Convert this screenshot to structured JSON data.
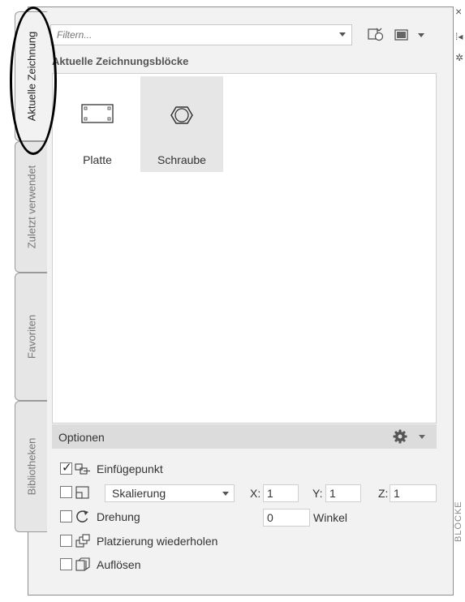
{
  "tabs": [
    {
      "label": "Aktuelle Zeichnung",
      "active": true
    },
    {
      "label": "Zuletzt verwendet",
      "active": false
    },
    {
      "label": "Favoriten",
      "active": false
    },
    {
      "label": "Bibliotheken",
      "active": false
    }
  ],
  "filter": {
    "placeholder": "Filtern..."
  },
  "toolbar": {
    "reload_icon": "load-icon",
    "view_icon": "thumbnail-view-icon"
  },
  "section_title": "Aktuelle Zeichnungsblöcke",
  "blocks": [
    {
      "name": "Platte",
      "icon": "plate-icon",
      "selected": false
    },
    {
      "name": "Schraube",
      "icon": "hex-bolt-icon",
      "selected": true
    }
  ],
  "options": {
    "title": "Optionen",
    "insertion_point": {
      "label": "Einfügepunkt",
      "checked": true
    },
    "scaling": {
      "checked": false,
      "mode": "Skalierung",
      "x_label": "X:",
      "x": "1",
      "y_label": "Y:",
      "y": "1",
      "z_label": "Z:",
      "z": "1"
    },
    "rotation": {
      "label": "Drehung",
      "checked": false,
      "value": "0",
      "unit_label": "Winkel"
    },
    "repeat": {
      "label": "Platzierung wiederholen",
      "checked": false
    },
    "explode": {
      "label": "Auflösen",
      "checked": false
    }
  },
  "palette": {
    "title": "BLÖCKE",
    "close_glyph": "×",
    "pin_glyph": "⁞◂",
    "settings_glyph": "✲"
  },
  "colors": {
    "panel_bg": "#f2f2f2",
    "selected_block": "#e6e6e6",
    "options_header": "#dcdcdc"
  }
}
